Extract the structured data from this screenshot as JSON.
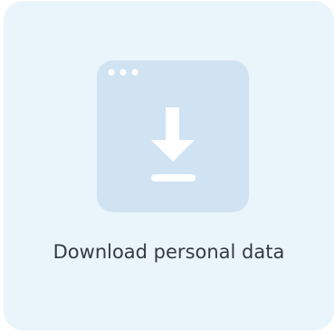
{
  "card": {
    "label": "Download personal data",
    "icon": "download-window-icon"
  },
  "colors": {
    "card_background": "#eaf4fb",
    "icon_window": "#cfe3f3",
    "icon_glyph": "#ffffff",
    "label_text": "#333b45"
  }
}
